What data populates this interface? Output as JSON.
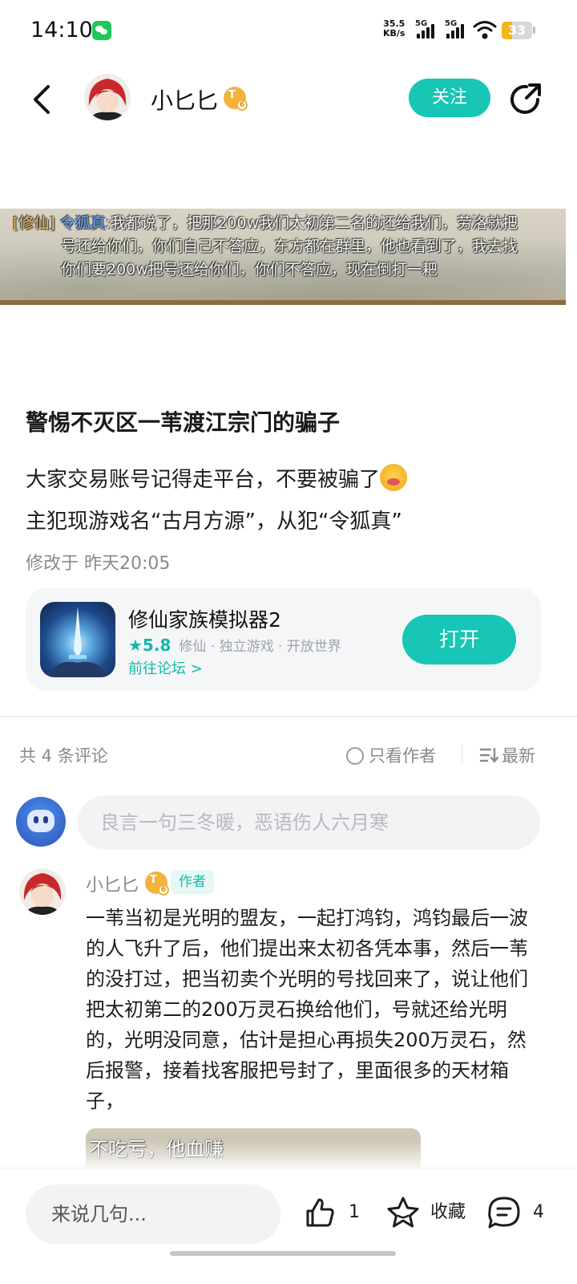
{
  "status_bar": {
    "time": "14:10",
    "speed_value": "35.5",
    "speed_unit": "KB/s",
    "signal1_label": "5G",
    "signal2_label": "5G",
    "battery": "33",
    "battery_level": 0.33
  },
  "header": {
    "username": "小匕匕",
    "level": "6",
    "follow_label": "关注"
  },
  "banner": {
    "tag": "[修仙]",
    "speaker": "令狐真",
    "line1": ":我都说了，把那200w我们太初第二名的还给我们，劳洛就把",
    "line2": "号还给你们，你们自己不答应，东方都在群里，他也看到了，我去找",
    "line3": "你们要200w把号还给你们，你们不答应，现在倒打一耙"
  },
  "post": {
    "title": "警惕不灭区一苇渡江宗门的骗子",
    "body_line1": "大家交易账号记得走平台，不要被骗了",
    "body_line2": "主犯现游戏名“古月方源”，从犯“令狐真”",
    "modified": "修改于 昨天20:05"
  },
  "game_card": {
    "name": "修仙家族模拟器2",
    "rating": "★5.8",
    "tags": "修仙 · 独立游戏 · 开放世界",
    "forum_link": "前往论坛 >",
    "open_label": "打开"
  },
  "comments_header": {
    "count": "共 4 条评论",
    "author_only": "只看作者",
    "sort": "最新"
  },
  "comment_input": {
    "placeholder": "良言一句三冬暖，恶语伤人六月寒"
  },
  "comment": {
    "username": "小匕匕",
    "level": "6",
    "author_tag": "作者",
    "text": "一苇当初是光明的盟友，一起打鸿钧，鸿钧最后一波的人飞升了后，他们提出来太初各凭本事，然后一苇的没打过，把当初卖个光明的号找回来了，说让他们把太初第二的200万灵石换给他们，号就还给光明的，光明没同意，估计是担心再损失200万灵石，然后报警，接着找客服把号封了，里面很多的天材箱子，",
    "image_text": "不吃亏，他血赚"
  },
  "bottom_bar": {
    "input_placeholder": "来说几句...",
    "likes": "1",
    "favorite_label": "收藏",
    "comments": "4"
  },
  "colors": {
    "accent": "#17c6b4",
    "battery": "#f5b418",
    "level_badge": "#f2b23c"
  }
}
